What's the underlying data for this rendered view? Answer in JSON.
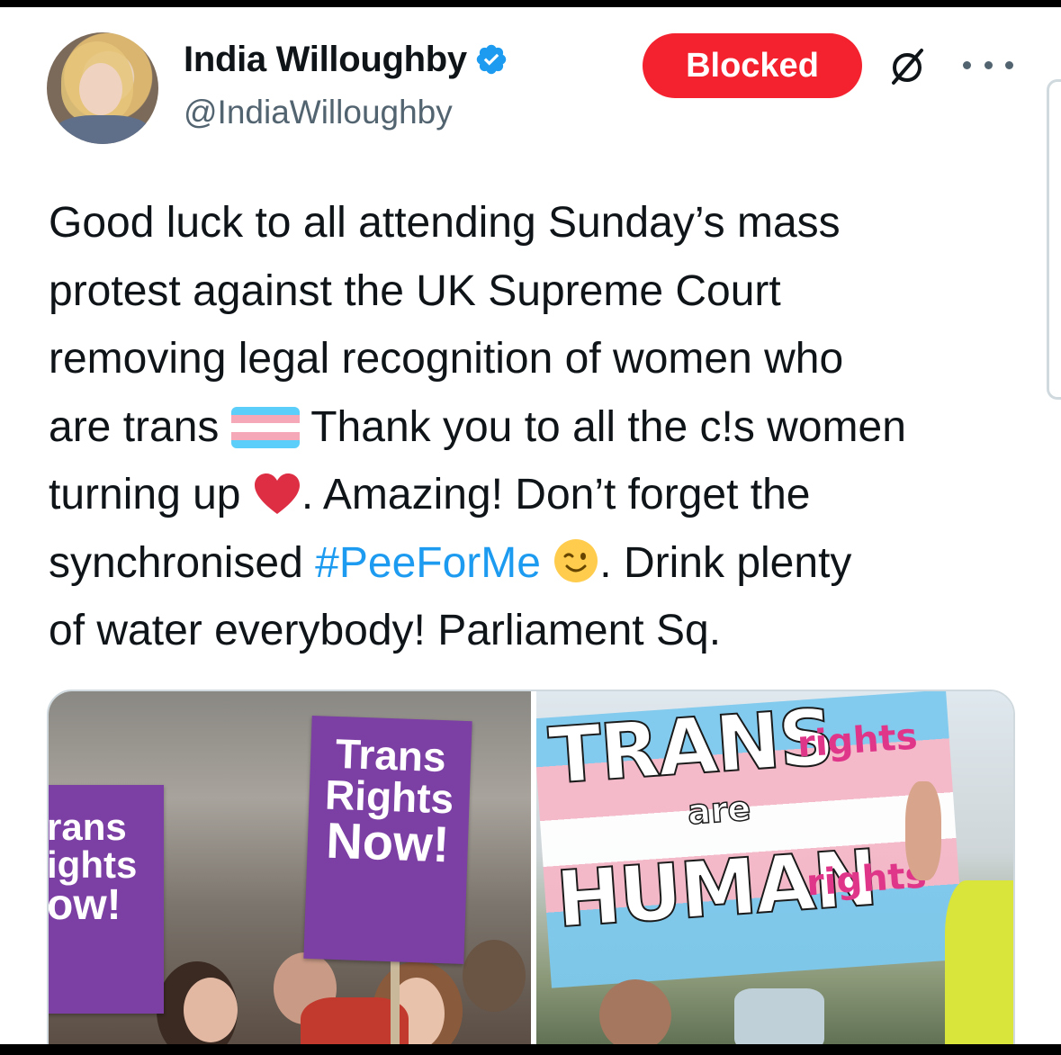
{
  "author": {
    "display_name": "India Willoughby",
    "handle": "@IndiaWilloughby",
    "verified": true,
    "avatar_icon": "profile-photo"
  },
  "actions": {
    "blocked_label": "Blocked",
    "grok_icon": "grok-icon",
    "more_icon": "more-options-icon"
  },
  "tweet": {
    "lines": [
      "Good luck to all attending Sunday’s mass",
      "protest against the UK Supreme Court",
      "removing legal recognition of women who",
      "are trans",
      "Thank you to all the c!s women",
      "turning up",
      ". Amazing! Don’t forget the",
      "synchronised",
      "#PeeForMe",
      ". Drink plenty",
      "of water everybody! Parliament Sq."
    ],
    "emojis": [
      "transgender-flag",
      "red-heart",
      "winking-face"
    ]
  },
  "media": {
    "left_photo": {
      "sign_center": [
        "Trans",
        "Rights",
        "Now!"
      ],
      "sign_left": [
        "rans",
        "ights",
        "ow!"
      ]
    },
    "right_photo": {
      "banner_top": "TRANS",
      "banner_top_small": "rights",
      "banner_middle": "are",
      "banner_bottom": "HUMAN",
      "banner_bottom_small": "rights"
    }
  },
  "colors": {
    "blocked_bg": "#f4212e",
    "hashtag": "#1d9bf0",
    "verified": "#1d9bf0",
    "secondary_text": "#536471",
    "sign_purple": "#7c3fa3"
  }
}
